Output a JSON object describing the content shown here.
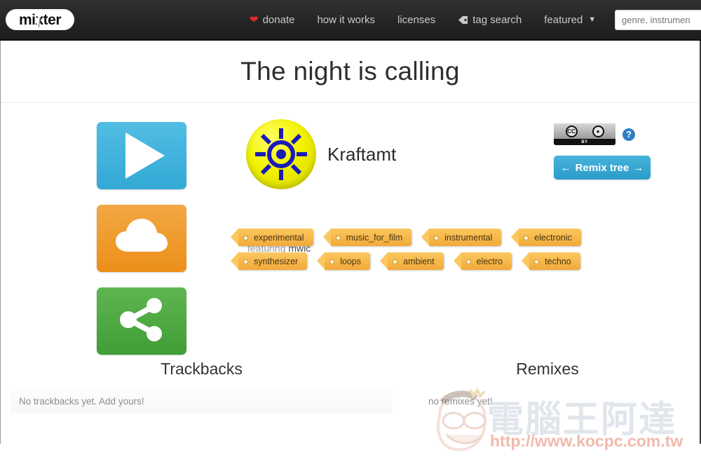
{
  "nav": {
    "logo_text": "mixter",
    "items": [
      {
        "label": "donate",
        "icon": "heart-icon"
      },
      {
        "label": "how it works",
        "icon": null
      },
      {
        "label": "licenses",
        "icon": null
      },
      {
        "label": "tag search",
        "icon": "tag-icon"
      },
      {
        "label": "featured",
        "icon": "chevron-down-icon"
      }
    ],
    "search_placeholder": "genre, instrumen"
  },
  "track": {
    "title": "The night is calling",
    "artist": "Kraftamt",
    "featuring_label": "featuring",
    "featuring_artist": "mwic",
    "tags": [
      "experimental",
      "music_for_film",
      "instrumental",
      "electronic",
      "synthesizer",
      "loops",
      "ambient",
      "electro",
      "techno"
    ]
  },
  "actions": {
    "play": "play-button",
    "download": "download-button",
    "share": "share-button"
  },
  "license": {
    "badge_cc": "CC",
    "badge_by": "BY",
    "help": "?",
    "remix_tree_label": "Remix tree",
    "arrow_left": "←",
    "arrow_right": "→"
  },
  "sections": {
    "trackbacks": {
      "title": "Trackbacks",
      "empty_text": "No trackbacks yet. Add yours!"
    },
    "remixes": {
      "title": "Remixes",
      "empty_text": "no remixes yet!"
    }
  },
  "watermark": {
    "text": "電腦王阿達",
    "url": "http://www.kocpc.com.tw"
  },
  "colors": {
    "nav_bg": "#252525",
    "play": "#33a9d6",
    "download": "#ec8f19",
    "share": "#3f9e35",
    "tag": "#f2a93a",
    "remix_tree": "#2b9bc9",
    "avatar_bg": "#f2f200",
    "avatar_symbol": "#1b1bb5"
  }
}
